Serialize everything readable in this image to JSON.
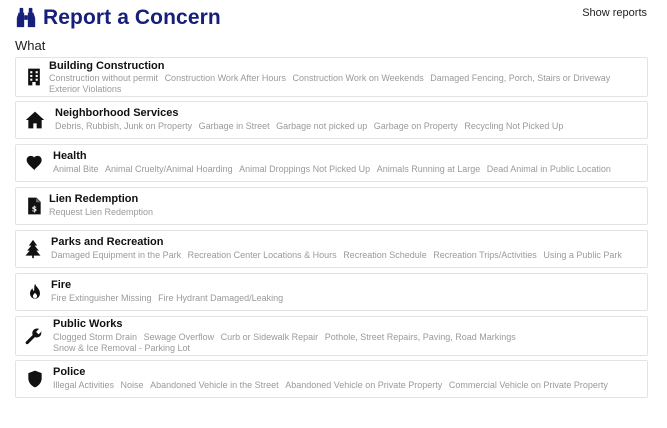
{
  "header": {
    "title": "Report a Concern",
    "icon": "binoculars-icon",
    "show_reports_label": "Show reports"
  },
  "section": {
    "label": "What"
  },
  "categories": [
    {
      "title": "Building Construction",
      "icon": "building-icon",
      "items": [
        "Construction without permit",
        "Construction Work After Hours",
        "Construction Work on Weekends",
        "Damaged Fencing, Porch, Stairs or Driveway",
        "Exterior Violations"
      ]
    },
    {
      "title": "Neighborhood Services",
      "icon": "house-icon",
      "items": [
        "Debris, Rubbish, Junk on Property",
        "Garbage in Street",
        "Garbage not picked up",
        "Garbage on Property",
        "Recycling Not Picked Up"
      ]
    },
    {
      "title": "Health",
      "icon": "heart-icon",
      "items": [
        "Animal Bite",
        "Animal Cruelty/Animal Hoarding",
        "Animal Droppings Not Picked Up",
        "Animals Running at Large",
        "Dead Animal in Public Location"
      ]
    },
    {
      "title": "Lien Redemption",
      "icon": "invoice-dollar-icon",
      "items": [
        "Request Lien Redemption"
      ]
    },
    {
      "title": "Parks and Recreation",
      "icon": "tree-icon",
      "items": [
        "Damaged Equipment in the Park",
        "Recreation Center Locations & Hours",
        "Recreation Schedule",
        "Recreation Trips/Activities",
        "Using a Public Park"
      ]
    },
    {
      "title": "Fire",
      "icon": "fire-icon",
      "items": [
        "Fire Extinguisher Missing",
        "Fire Hydrant Damaged/Leaking"
      ]
    },
    {
      "title": "Public Works",
      "icon": "wrench-icon",
      "items": [
        "Clogged Storm Drain",
        "Sewage Overflow",
        "Curb or Sidewalk Repair",
        "Pothole, Street Repairs, Paving, Road Markings",
        "Snow & Ice Removal - Parking Lot"
      ]
    },
    {
      "title": "Police",
      "icon": "shield-icon",
      "items": [
        "Illegal Activities",
        "Noise",
        "Abandoned Vehicle in the Street",
        "Abandoned Vehicle on Private Property",
        "Commercial Vehicle on Private Property"
      ]
    }
  ]
}
